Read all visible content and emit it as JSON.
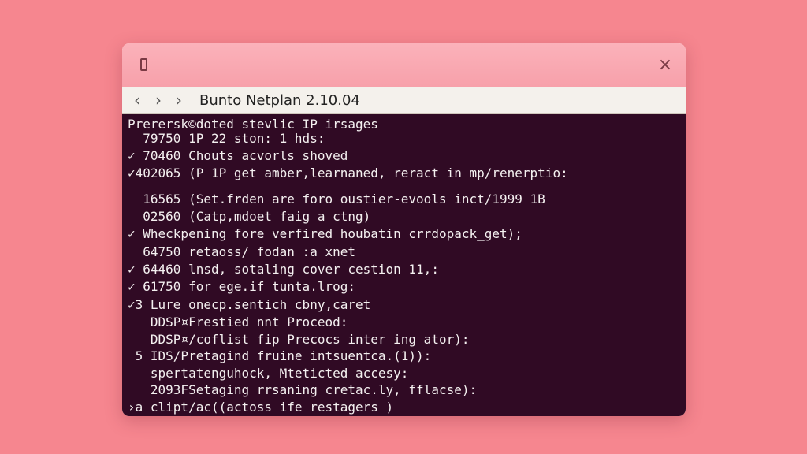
{
  "window": {
    "title": "Bunto Netplan 2.10.04",
    "icons": {
      "app": "window-app-icon",
      "close": "close-icon",
      "back": "chevron-left-icon",
      "forward": "chevron-right-icon",
      "next": "chevron-right-icon"
    },
    "close_label": "×",
    "nav": {
      "back": "‹",
      "forward": "›",
      "next": "›"
    }
  },
  "terminal": {
    "lines": [
      "Prerersk©doted stevlic IP irsages",
      "  79750 1P 22 ston: 1 hds:",
      "✓ 70460 Chouts acvorls shoved",
      "✓402065 (P 1P get amber,learnaned, reract in mp/renerptio:",
      "  16565 (Set.frden are foro oustier-evools inct/1999 1B",
      "  02560 (Catp,mdoet faig a ctng)",
      "✓ Wheckpening fore verfired houbatin crrdopack_get);",
      "  64750 retaoss/ fodan :a xnet",
      "✓ 64460 lnsd, sotaling cover cestion 11,:",
      "✓ 61750 for ege.if tunta.lrog:",
      "✓3 Lure onecp.sentich cbny,caret",
      "   DDSP¤Frestied nnt Proceod:",
      "   DDSP¤/coflist fip Precocs inter ing ator):",
      " 5 IDS/Pretagind fruine intsuentca.(1)):",
      "   spertatenguhock, Mteticted accesy:",
      "   2093FSetaging rrsaning cretac.ly, fflacse):",
      "›a clipt/ac((actoss ife restagers )"
    ],
    "colors": {
      "background": "#300a24",
      "text": "#f4f0f0"
    }
  },
  "colors": {
    "desktop": "#f6868f",
    "titlebar": "#f8a7b0"
  }
}
